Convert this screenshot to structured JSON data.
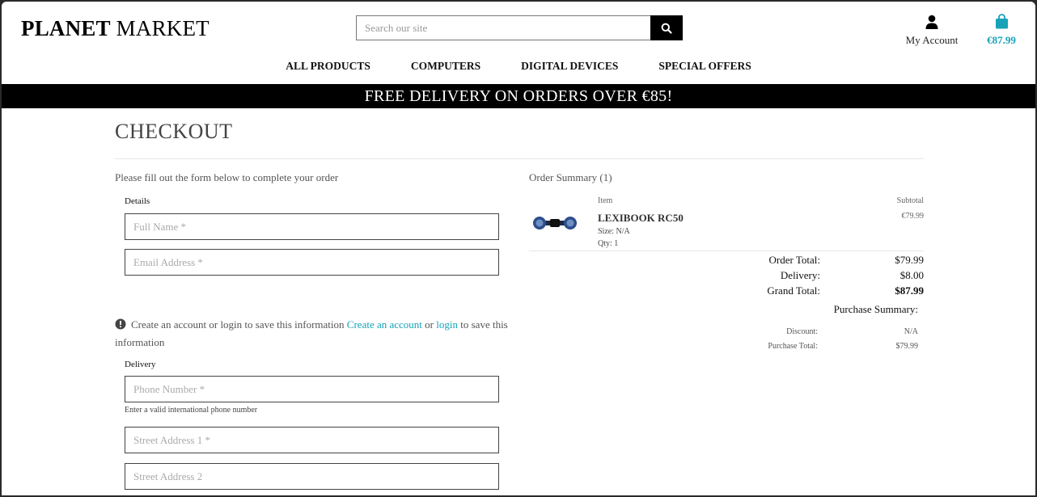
{
  "header": {
    "brand_bold": "PLANET",
    "brand_rest": "MARKET",
    "search_placeholder": "Search our site",
    "account_label": "My Account",
    "bag_total": "€87.99"
  },
  "nav": {
    "items": [
      "ALL PRODUCTS",
      "COMPUTERS",
      "DIGITAL DEVICES",
      "SPECIAL OFFERS"
    ]
  },
  "banner": "FREE DELIVERY ON ORDERS OVER €85!",
  "checkout": {
    "title": "CHECKOUT",
    "intro": "Please fill out the form below to complete your order",
    "details_label": "Details",
    "full_name_placeholder": "Full Name *",
    "email_placeholder": "Email Address *",
    "note_text": "Create an account or login to save this information",
    "note_link_create": "Create an account",
    "note_or": "or",
    "note_link_login": "login",
    "note_tail": "to save this information",
    "delivery_label": "Delivery",
    "phone_placeholder": "Phone Number *",
    "phone_hint": "Enter a valid international phone number",
    "street1_placeholder": "Street Address 1 *",
    "street2_placeholder": "Street Address 2"
  },
  "summary": {
    "heading": "Order Summary (1)",
    "col_item": "Item",
    "col_subtotal": "Subtotal",
    "product": {
      "name": "LEXIBOOK RC50",
      "size": "Size: N/A",
      "qty": "Qty: 1",
      "subtotal": "€79.99"
    },
    "order_total_label": "Order Total:",
    "order_total": "$79.99",
    "delivery_label": "Delivery:",
    "delivery": "$8.00",
    "grand_total_label": "Grand Total:",
    "grand_total": "$87.99",
    "purchase_summary_label": "Purchase Summary:",
    "discount_label": "Discount:",
    "discount": "N/A",
    "purchase_total_label": "Purchase Total:",
    "purchase_total": "$79.99"
  },
  "colors": {
    "accent": "#17a2b8",
    "banner_bg": "#000000"
  }
}
